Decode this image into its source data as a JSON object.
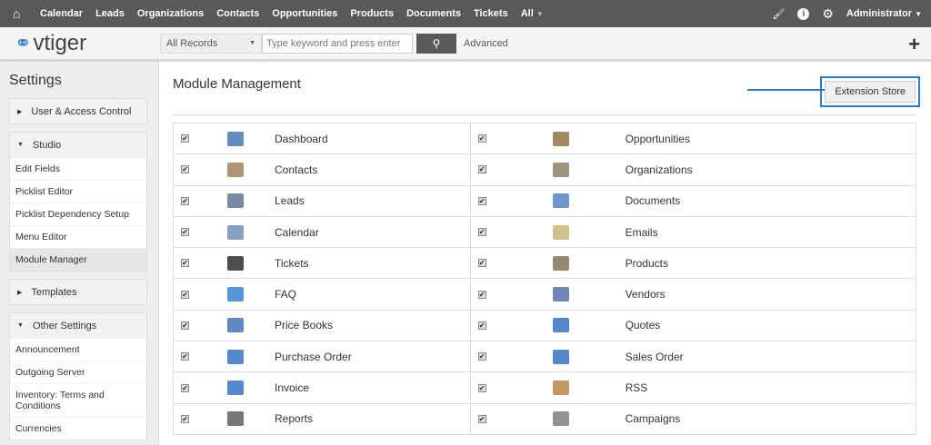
{
  "topnav": {
    "items": [
      "Calendar",
      "Leads",
      "Organizations",
      "Contacts",
      "Opportunities",
      "Products",
      "Documents",
      "Tickets",
      "All"
    ],
    "user": "Administrator"
  },
  "header": {
    "logo": "vtiger",
    "search_scope": "All Records",
    "search_placeholder": "Type keyword and press enter",
    "advanced": "Advanced"
  },
  "sidebar": {
    "title": "Settings",
    "panels": [
      {
        "label": "User & Access Control",
        "expanded": false,
        "items": []
      },
      {
        "label": "Studio",
        "expanded": true,
        "items": [
          "Edit Fields",
          "Picklist Editor",
          "Picklist Dependency Setup",
          "Menu Editor",
          "Module Manager"
        ]
      },
      {
        "label": "Templates",
        "expanded": false,
        "items": []
      },
      {
        "label": "Other Settings",
        "expanded": true,
        "items": [
          "Announcement",
          "Outgoing Server",
          "Inventory: Terms and Conditions",
          "Currencies"
        ]
      }
    ]
  },
  "main": {
    "title": "Module Management",
    "extension_store": "Extension Store",
    "rows": [
      [
        {
          "name": "Dashboard",
          "icon": "dashboard-icon"
        },
        {
          "name": "Opportunities",
          "icon": "money-bag-icon"
        }
      ],
      [
        {
          "name": "Contacts",
          "icon": "person-icon"
        },
        {
          "name": "Organizations",
          "icon": "building-icon"
        }
      ],
      [
        {
          "name": "Leads",
          "icon": "lead-card-icon"
        },
        {
          "name": "Documents",
          "icon": "document-icon"
        }
      ],
      [
        {
          "name": "Calendar",
          "icon": "calendar-icon"
        },
        {
          "name": "Emails",
          "icon": "envelope-icon"
        }
      ],
      [
        {
          "name": "Tickets",
          "icon": "headset-icon"
        },
        {
          "name": "Products",
          "icon": "product-box-icon"
        }
      ],
      [
        {
          "name": "FAQ",
          "icon": "globe-icon"
        },
        {
          "name": "Vendors",
          "icon": "truck-icon"
        }
      ],
      [
        {
          "name": "Price Books",
          "icon": "pricebook-icon"
        },
        {
          "name": "Quotes",
          "icon": "quote-icon"
        }
      ],
      [
        {
          "name": "Purchase Order",
          "icon": "purchase-order-icon"
        },
        {
          "name": "Sales Order",
          "icon": "sales-order-icon"
        }
      ],
      [
        {
          "name": "Invoice",
          "icon": "invoice-icon"
        },
        {
          "name": "RSS",
          "icon": "rss-icon"
        }
      ],
      [
        {
          "name": "Reports",
          "icon": "reports-icon"
        },
        {
          "name": "Campaigns",
          "icon": "megaphone-icon"
        }
      ]
    ]
  }
}
